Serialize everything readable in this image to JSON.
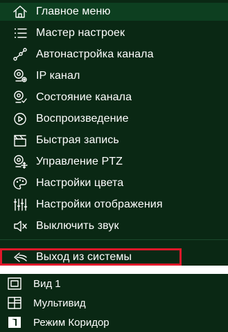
{
  "main_menu": {
    "items": [
      {
        "label": "Главное меню",
        "icon": "home-icon",
        "active": true
      },
      {
        "label": "Мастер настроек",
        "icon": "list-icon"
      },
      {
        "label": "Автонастройка канала",
        "icon": "network-nodes-icon"
      },
      {
        "label": "IP канал",
        "icon": "camera-add-icon"
      },
      {
        "label": "Состояние канала",
        "icon": "camera-check-icon"
      },
      {
        "label": "Воспроизведение",
        "icon": "play-circle-icon"
      },
      {
        "label": "Быстрая запись",
        "icon": "record-icon"
      },
      {
        "label": "Управление PTZ",
        "icon": "ptz-camera-icon"
      },
      {
        "label": "Настройки цвета",
        "icon": "palette-icon"
      },
      {
        "label": "Настройки отображения",
        "icon": "sliders-icon"
      },
      {
        "label": "Выключить звук",
        "icon": "mute-speaker-icon"
      },
      {
        "label": "Выход из системы",
        "icon": "back-arrow-icon",
        "highlighted": true
      }
    ]
  },
  "view_menu": {
    "items": [
      {
        "label": "Вид 1",
        "icon": "single-view-icon"
      },
      {
        "label": "Мультивид",
        "icon": "multi-view-icon"
      },
      {
        "label": "Режим Коридор",
        "icon": "corridor-mode-icon"
      }
    ]
  },
  "colors": {
    "menu_bg": "#0a2814",
    "active_bg": "#0d3f20",
    "highlight_border": "#e0182a",
    "text": "#ffffff"
  }
}
